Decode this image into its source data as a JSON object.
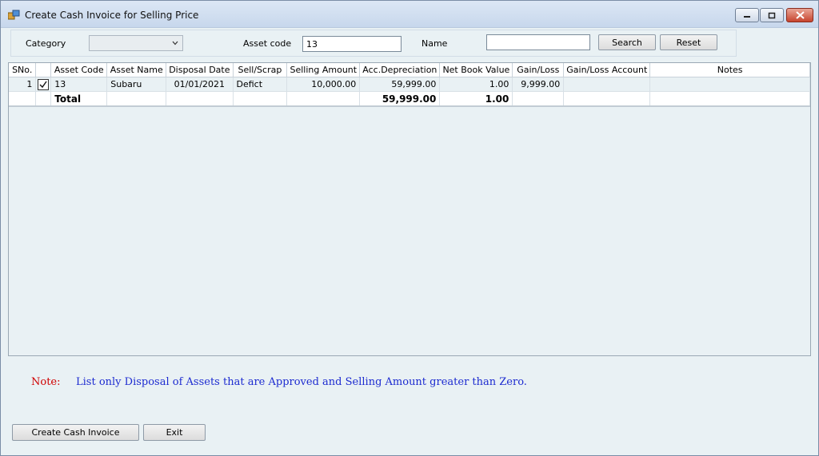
{
  "window": {
    "title": "Create Cash Invoice for Selling Price"
  },
  "filters": {
    "category_label": "Category",
    "category_value": "",
    "asset_code_label": "Asset code",
    "asset_code_value": "13",
    "name_label": "Name",
    "name_value": "",
    "search_label": "Search",
    "reset_label": "Reset"
  },
  "grid": {
    "columns": [
      "SNo.",
      "",
      "Asset Code",
      "Asset Name",
      "Disposal Date",
      "Sell/Scrap",
      "Selling Amount",
      "Acc.Depreciation",
      "Net Book Value",
      "Gain/Loss",
      "Gain/Loss Account",
      "Notes"
    ],
    "rows": [
      {
        "sno": "1",
        "checked": true,
        "asset_code": "13",
        "asset_name": "Subaru",
        "disposal_date": "01/01/2021",
        "sell_scrap": "Defict",
        "selling_amount": "10,000.00",
        "acc_depreciation": "59,999.00",
        "net_book_value": "1.00",
        "gain_loss": "9,999.00",
        "gain_loss_account": "",
        "notes": ""
      }
    ],
    "total": {
      "label": "Total",
      "acc_depreciation": "59,999.00",
      "net_book_value": "1.00"
    }
  },
  "note": {
    "label": "Note:",
    "text": "List only Disposal of Assets that are Approved and Selling Amount greater than Zero."
  },
  "actions": {
    "create_label": "Create Cash Invoice",
    "exit_label": "Exit"
  }
}
